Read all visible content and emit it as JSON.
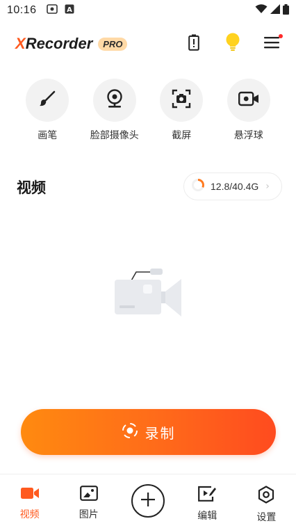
{
  "status_bar": {
    "time": "10:16",
    "icons_left": [
      "cast-icon",
      "a-icon"
    ],
    "icons_right": [
      "wifi-icon",
      "signal-icon",
      "battery-icon"
    ]
  },
  "header": {
    "logo_x": "X",
    "logo_rest": "Recorder",
    "pro_badge": "PRO",
    "actions": [
      "battery-alert-icon",
      "bulb-icon",
      "menu-icon"
    ],
    "menu_has_notification": true
  },
  "tools": [
    {
      "label": "画笔",
      "icon": "brush-icon"
    },
    {
      "label": "脸部摄像头",
      "icon": "webcam-icon"
    },
    {
      "label": "截屏",
      "icon": "screenshot-icon"
    },
    {
      "label": "悬浮球",
      "icon": "floating-ball-icon"
    }
  ],
  "video_section": {
    "title": "视频",
    "storage": "12.8/40.4G",
    "storage_used_fraction": 0.32,
    "empty_state_icon": "video-camera-empty-icon"
  },
  "record_button": {
    "label": "录制",
    "icon": "record-icon"
  },
  "bottom_nav": [
    {
      "label": "视频",
      "icon": "video-icon",
      "active": true
    },
    {
      "label": "图片",
      "icon": "image-icon",
      "active": false
    },
    {
      "label": "",
      "icon": "add-icon",
      "active": false
    },
    {
      "label": "编辑",
      "icon": "edit-video-icon",
      "active": false
    },
    {
      "label": "设置",
      "icon": "settings-icon",
      "active": false
    }
  ],
  "colors": {
    "accent": "#ff5a1f",
    "gradient_start": "#ff8a10",
    "gradient_end": "#ff4b1f",
    "pro_badge_bg": "#ffd9a6",
    "tool_bg": "#f2f2f2"
  }
}
